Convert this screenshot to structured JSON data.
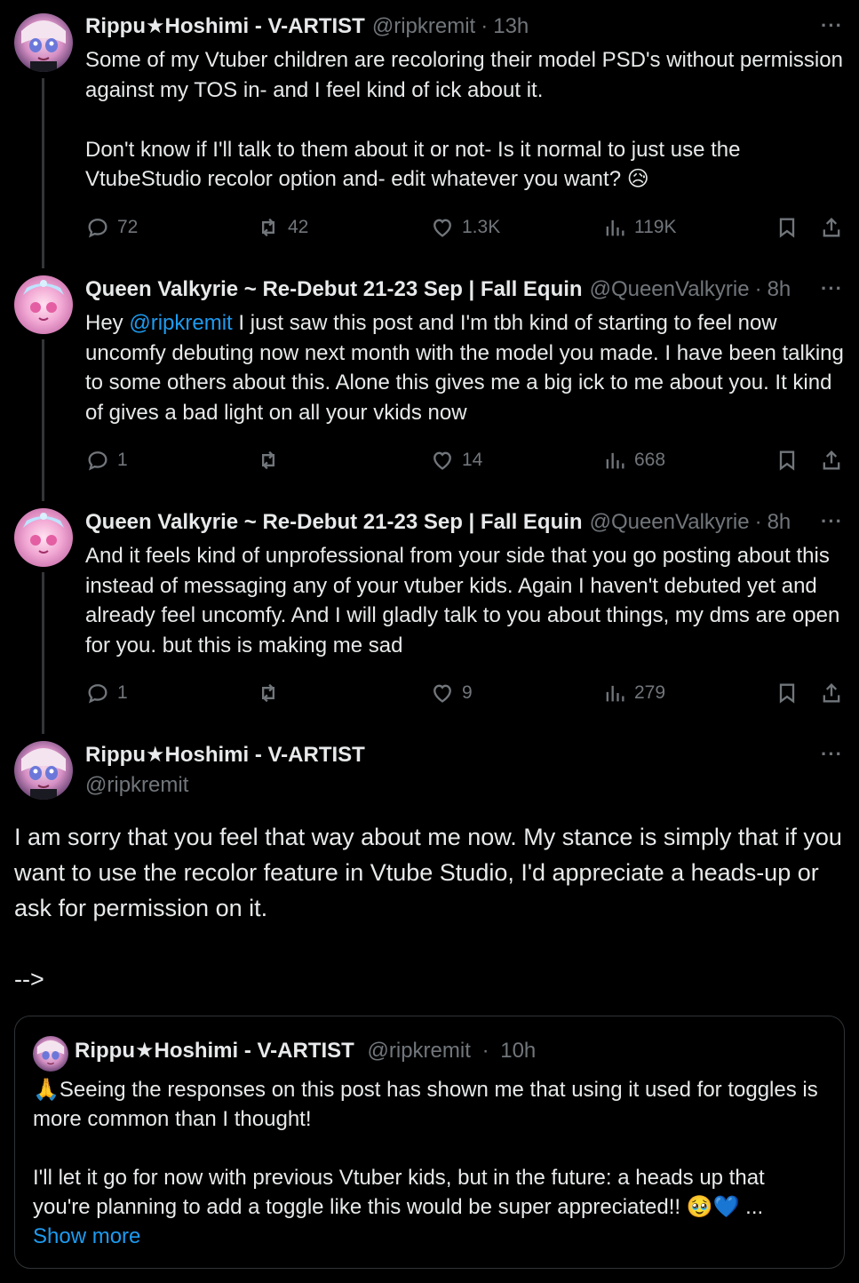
{
  "tweets": [
    {
      "name": "Rippu★Hoshimi - V-ARTIST",
      "handle": "@ripkremit",
      "time": "13h",
      "text": "Some of my Vtuber children are recoloring their model PSD's without permission against my TOS in- and I feel kind of ick about it.\n\nDon't know if I'll talk to them about it or not- Is it normal to just use the VtubeStudio recolor option and- edit whatever you want? 😥",
      "replies": "72",
      "retweets": "42",
      "likes": "1.3K",
      "views": "119K"
    },
    {
      "name": "Queen Valkyrie ~ Re-Debut 21-23 Sep | Fall Equin",
      "handle": "@QueenValkyrie",
      "time": "8h",
      "text_pre": "Hey ",
      "mention": "@ripkremit",
      "text_post": " I just saw this post and I'm tbh kind of starting to feel now uncomfy debuting now next month with the model you made. I have been talking to some others about this. Alone this gives me a big ick to me about you. It kind of gives a bad light on all your vkids now",
      "replies": "1",
      "retweets": "",
      "likes": "14",
      "views": "668"
    },
    {
      "name": "Queen Valkyrie ~ Re-Debut 21-23 Sep | Fall Equin",
      "handle": "@QueenValkyrie",
      "time": "8h",
      "text": "And it feels kind of unprofessional from your side that you go posting about this instead of messaging any of your vtuber kids. Again I haven't debuted yet and already feel uncomfy. And I will gladly talk to you about things, my dms are open for you. but this is making me sad",
      "replies": "1",
      "retweets": "",
      "likes": "9",
      "views": "279"
    }
  ],
  "main": {
    "name": "Rippu★Hoshimi - V-ARTIST",
    "handle": "@ripkremit",
    "text": "I am sorry that you feel that way about me now. My stance is simply that if you want to use the recolor feature in Vtube Studio, I'd appreciate a heads-up or ask for permission on it.\n\n-->"
  },
  "quote": {
    "name": "Rippu★Hoshimi - V-ARTIST",
    "handle": "@ripkremit",
    "time": "10h",
    "text": "🙏Seeing the responses on this post has shown me that using it used for toggles is more common than I thought!\n\nI'll let it go for now with previous Vtuber kids, but in the future: a heads up that you're planning to add a toggle like this would be super appreciated!! 🥹💙 ...",
    "show_more": "Show more"
  },
  "ui": {
    "more": "···",
    "dot": "·"
  },
  "icons": {
    "reply": "reply-icon",
    "retweet": "retweet-icon",
    "like": "heart-icon",
    "views": "views-icon",
    "bookmark": "bookmark-icon",
    "share": "share-icon"
  },
  "colors": {
    "background": "#000000",
    "text": "#e7e9ea",
    "muted": "#71767b",
    "link": "#1d9bf0",
    "border": "#2f3336"
  }
}
